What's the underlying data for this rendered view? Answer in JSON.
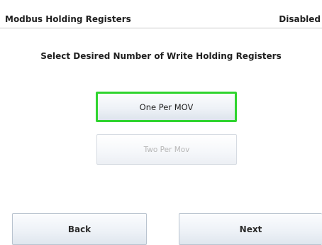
{
  "header": {
    "title": "Modbus Holding Registers",
    "status": "Disabled"
  },
  "prompt": "Select Desired Number of Write Holding Registers",
  "options": [
    {
      "label": "One Per MOV",
      "state": "selected"
    },
    {
      "label": "Two Per Mov",
      "state": "disabled"
    }
  ],
  "nav": {
    "back_label": "Back",
    "next_label": "Next"
  },
  "colors": {
    "selection_border": "#2fd42f",
    "disabled_text": "#b7b7b7"
  }
}
